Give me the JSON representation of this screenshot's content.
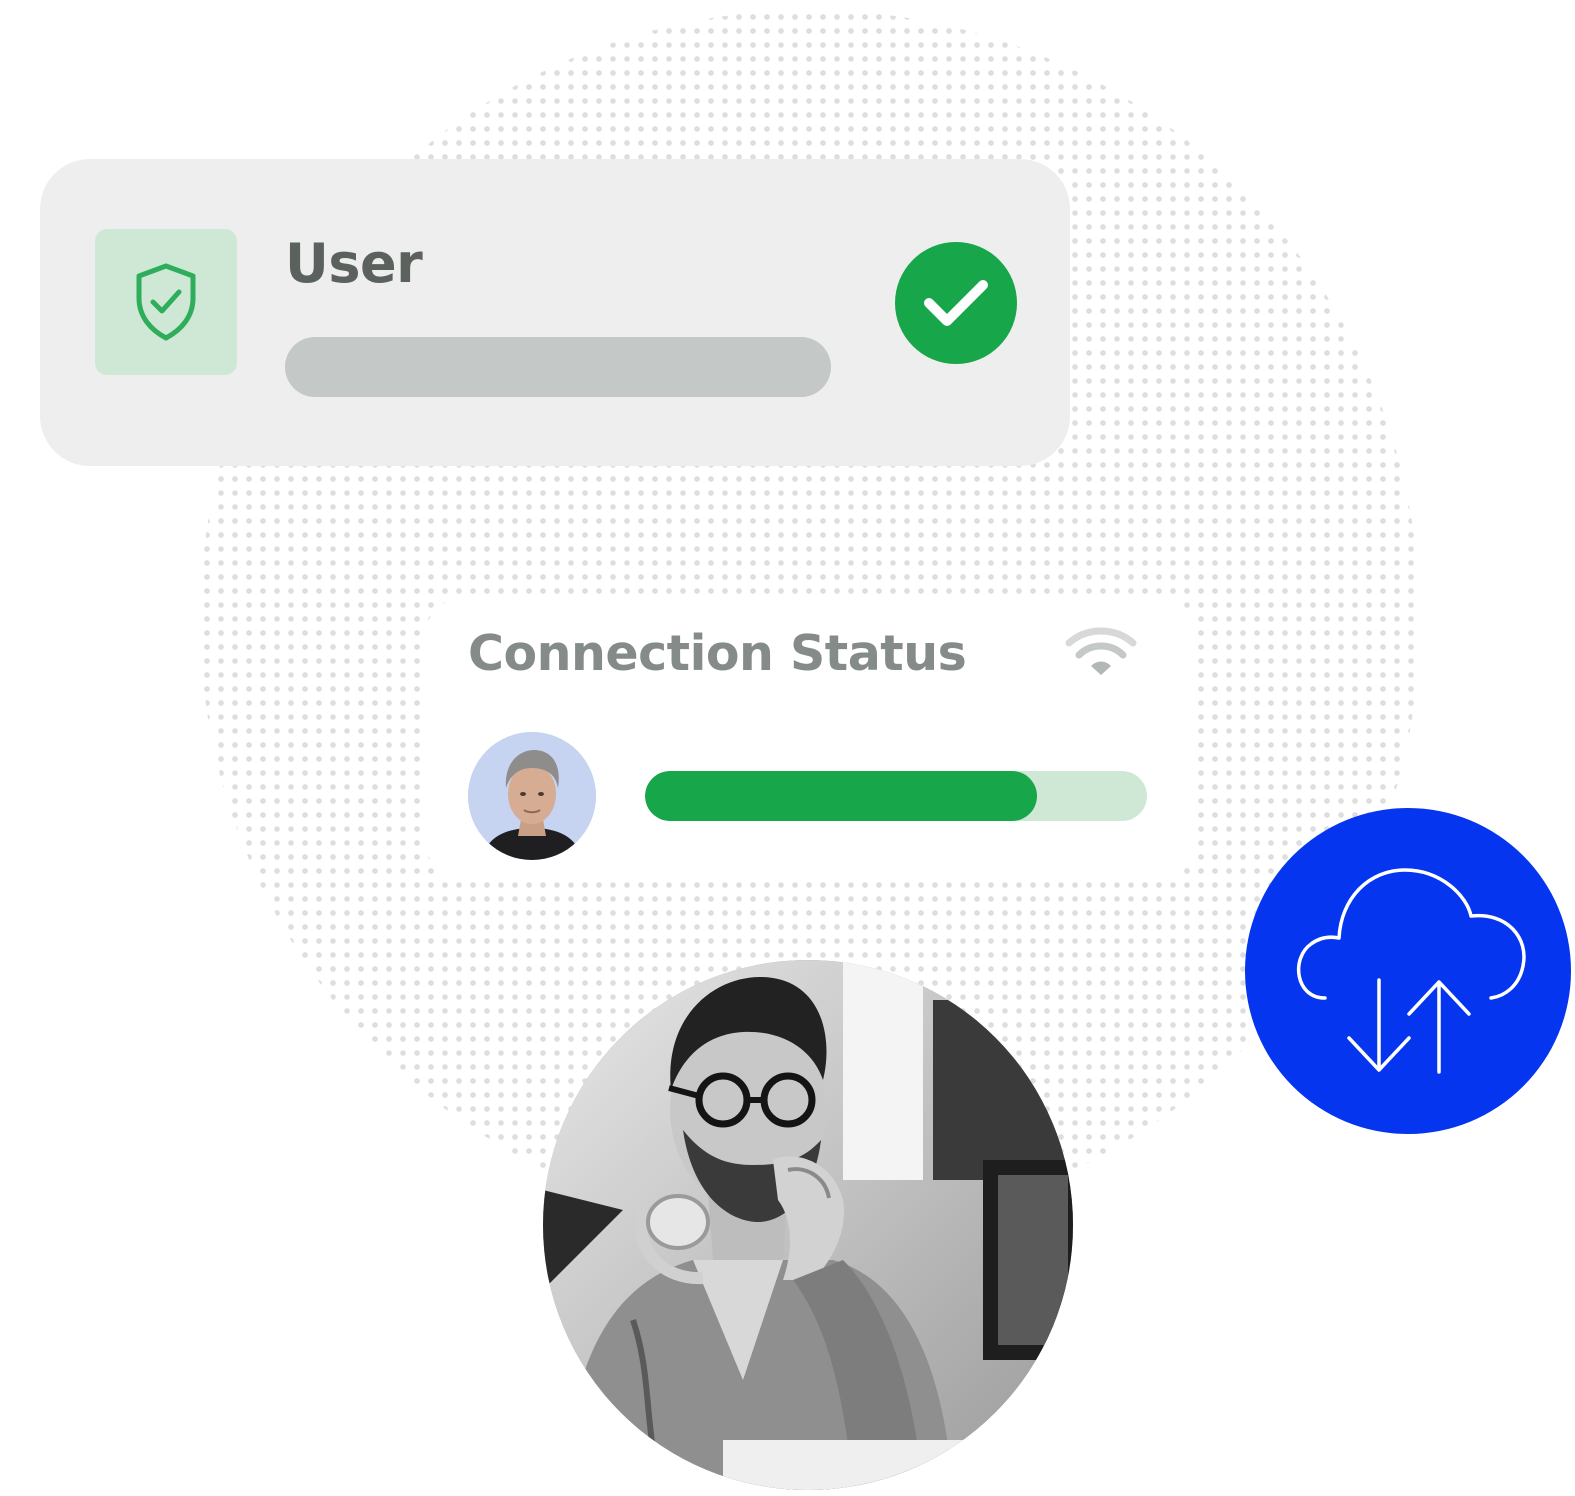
{
  "user_card": {
    "title": "User",
    "shield_icon": "shield-check-icon",
    "status_icon": "check-circle-icon"
  },
  "connection_card": {
    "title": "Connection Status",
    "wifi_icon": "wifi-icon",
    "progress_percent": 78
  },
  "sync_badge": {
    "icon": "cloud-upload-download-icon"
  },
  "colors": {
    "success_green": "#17a649",
    "light_green": "#cfe8d6",
    "card_gray": "#edeeed",
    "bar_gray": "#c4c8c6",
    "brand_blue": "#0535ef",
    "title_gray": "#5b625e"
  }
}
